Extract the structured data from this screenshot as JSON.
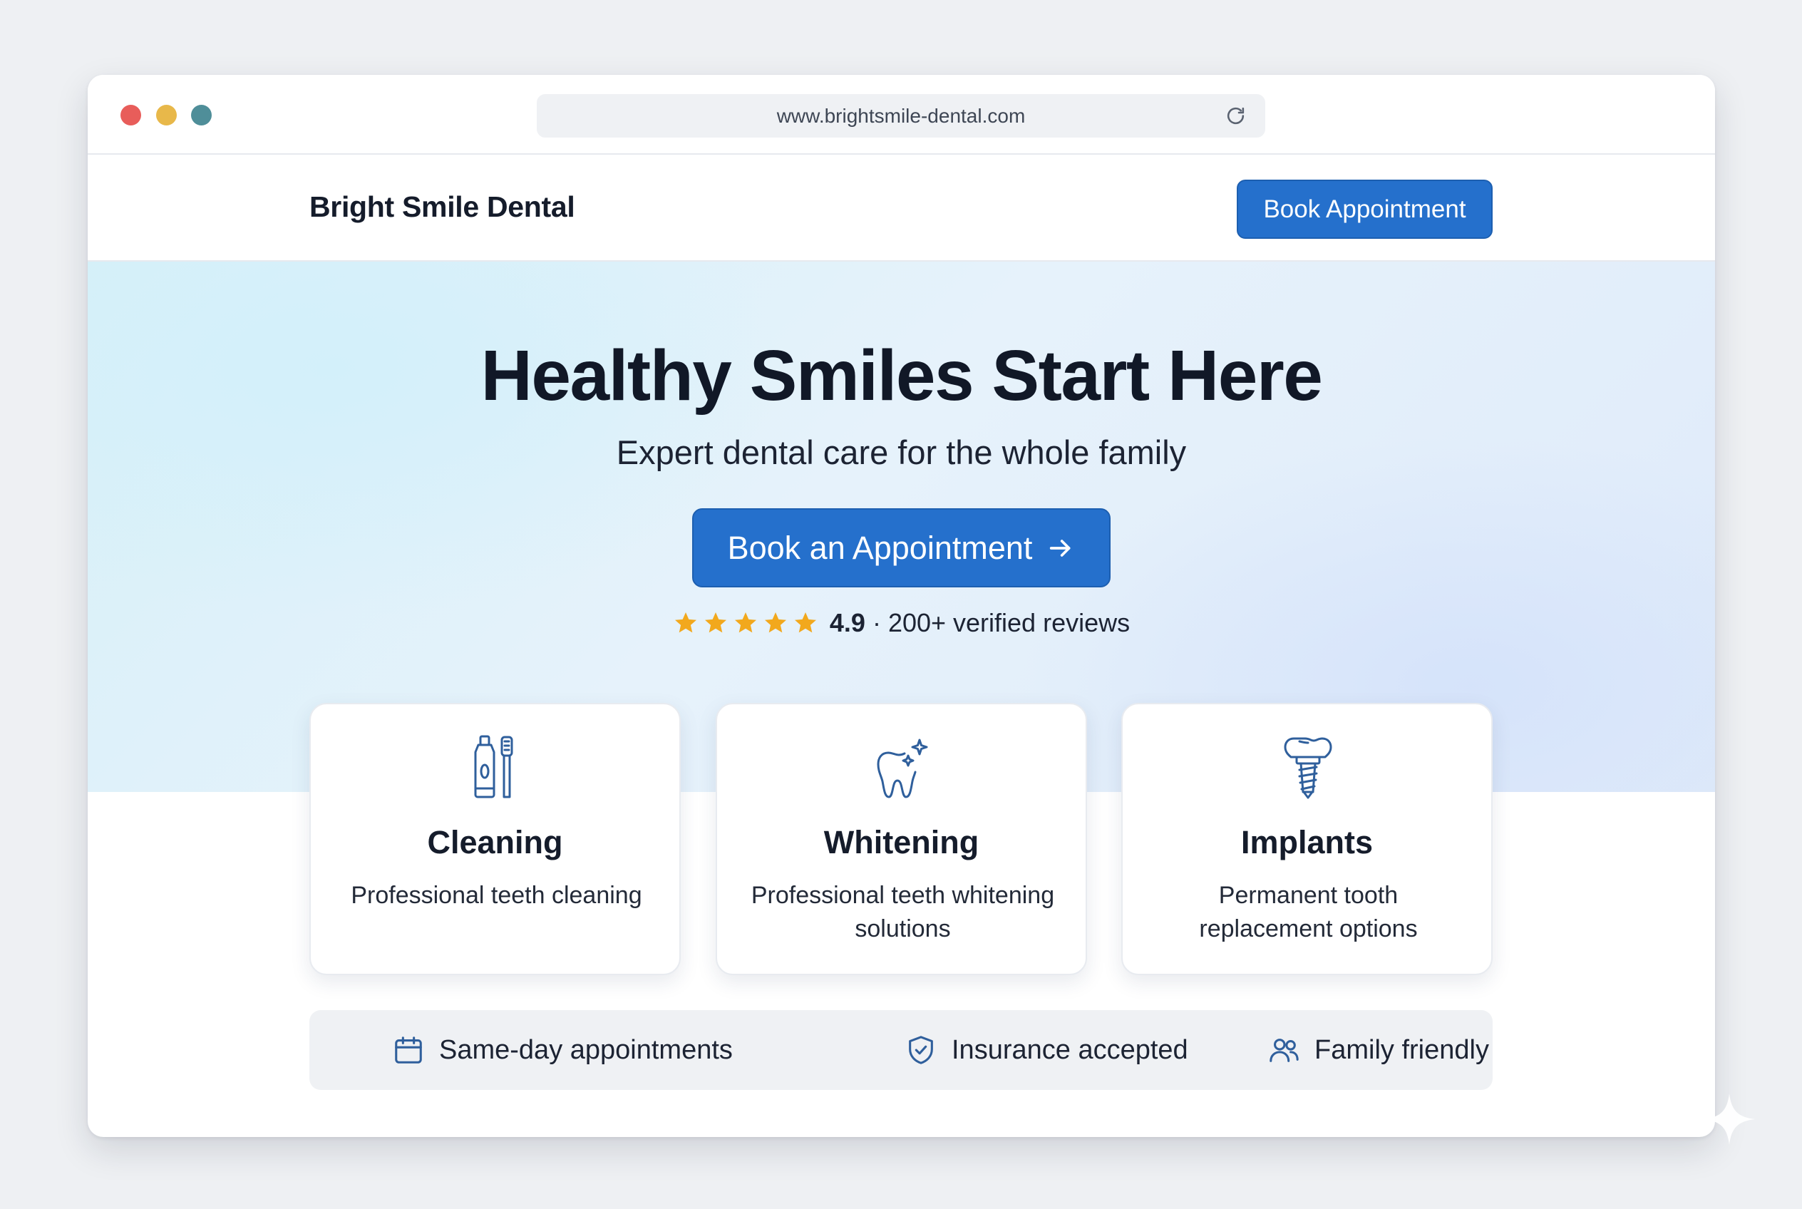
{
  "browser": {
    "url": "www.brightsmile-dental.com"
  },
  "navbar": {
    "brand": "Bright Smile Dental",
    "cta_label": "Book Appointment"
  },
  "hero": {
    "title": "Healthy Smiles Start Here",
    "subtitle": "Expert dental care for the whole family",
    "cta_label": "Book an Appointment",
    "rating": {
      "stars": 5,
      "value": "4.9",
      "separator": "·",
      "reviews": "200+ verified reviews"
    }
  },
  "services": [
    {
      "icon": "toothpaste-toothbrush-icon",
      "title": "Cleaning",
      "description": "Professional teeth cleaning"
    },
    {
      "icon": "sparkling-tooth-icon",
      "title": "Whitening",
      "description": "Professional teeth whitening solutions"
    },
    {
      "icon": "dental-implant-icon",
      "title": "Implants",
      "description": "Permanent tooth replacement options"
    }
  ],
  "features": [
    {
      "icon": "calendar-icon",
      "label": "Same-day appointments"
    },
    {
      "icon": "shield-check-icon",
      "label": "Insurance accepted"
    },
    {
      "icon": "users-icon",
      "label": "Family friendly"
    }
  ],
  "colors": {
    "accent": "#2570cc",
    "star": "#f2a81d",
    "icon": "#2f5f9c"
  }
}
